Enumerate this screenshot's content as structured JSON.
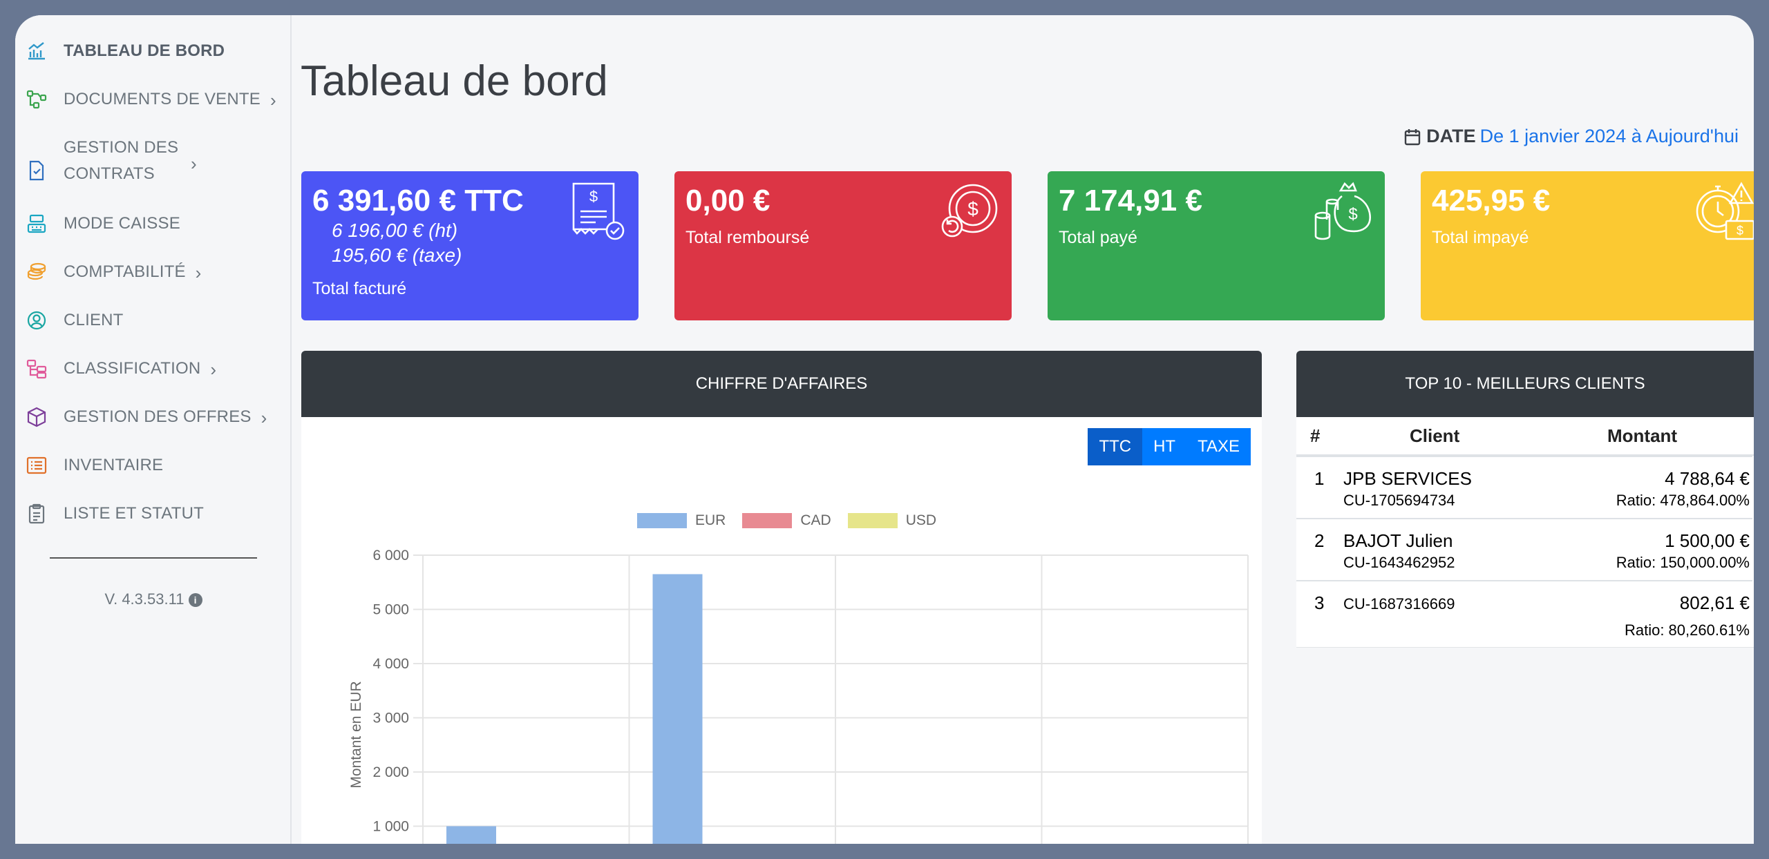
{
  "sidebar": {
    "items": [
      {
        "label": "TABLEAU DE BORD",
        "icon": "chart-icon",
        "color": "#2f98c9",
        "active": true
      },
      {
        "label": "DOCUMENTS DE VENTE",
        "icon": "share-nodes-icon",
        "color": "#3aa44e",
        "chevron": "›"
      },
      {
        "label": "GESTION DES CONTRATS",
        "icon": "contract-icon",
        "color": "#2f6fbf",
        "chevron": "›"
      },
      {
        "label": "MODE CAISSE",
        "icon": "cash-register-icon",
        "color": "#19a6c2"
      },
      {
        "label": "COMPTABILITÉ",
        "icon": "coins-icon",
        "color": "#f0a030",
        "chevron": "›"
      },
      {
        "label": "CLIENT",
        "icon": "user-circle-icon",
        "color": "#19a6a2"
      },
      {
        "label": "CLASSIFICATION",
        "icon": "folder-tree-icon",
        "color": "#e05a9a",
        "chevron": "›"
      },
      {
        "label": "GESTION DES OFFRES",
        "icon": "box-icon",
        "color": "#7d3f9a",
        "chevron": "›"
      },
      {
        "label": "INVENTAIRE",
        "icon": "list-icon",
        "color": "#e0702a"
      },
      {
        "label": "LISTE ET STATUT",
        "icon": "clipboard-icon",
        "color": "#6c757d"
      }
    ],
    "version": "V. 4.3.53.11"
  },
  "header": {
    "title": "Tableau de bord",
    "date_label": "DATE",
    "date_range": "De 1 janvier 2024 à Aujourd'hui"
  },
  "cards": [
    {
      "amount": "6 391,60 € TTC",
      "sub1": "6 196,00 € (ht)",
      "sub2": "195,60 € (taxe)",
      "caption": "Total facturé",
      "color": "#4c55f5",
      "icon": "receipt-icon"
    },
    {
      "amount": "0,00 €",
      "caption": "Total remboursé",
      "color": "#dc3545",
      "icon": "refund-icon"
    },
    {
      "amount": "7 174,91 €",
      "caption": "Total payé",
      "color": "#35a853",
      "icon": "money-bag-icon"
    },
    {
      "amount": "425,95 €",
      "caption": "Total impayé",
      "color": "#fbc932",
      "icon": "overdue-icon"
    }
  ],
  "revenue_panel": {
    "title": "CHIFFRE D'AFFAIRES",
    "buttons": [
      "TTC",
      "HT",
      "TAXE"
    ],
    "active_button": "TTC"
  },
  "chart_data": {
    "type": "bar",
    "ylabel": "Montant en EUR",
    "ylim": [
      0,
      6000
    ],
    "yticks": [
      "1 000",
      "2 000",
      "3 000",
      "4 000",
      "5 000",
      "6 000"
    ],
    "grid": true,
    "legend_position": "top",
    "series": [
      {
        "name": "EUR",
        "color": "#8db5e6",
        "values": [
          1000,
          5650,
          null,
          null
        ]
      },
      {
        "name": "CAD",
        "color": "#e88a92",
        "values": [
          null,
          null,
          null,
          null
        ]
      },
      {
        "name": "USD",
        "color": "#e6e58a",
        "values": [
          null,
          null,
          null,
          null
        ]
      }
    ]
  },
  "top_clients": {
    "title": "TOP 10 - MEILLEURS CLIENTS",
    "headers": [
      "#",
      "Client",
      "Montant"
    ],
    "rows": [
      {
        "rank": "1",
        "name": "JPB SERVICES",
        "code": "CU-1705694734",
        "amount": "4 788,64 €",
        "ratio": "Ratio: 478,864.00%"
      },
      {
        "rank": "2",
        "name": "BAJOT Julien",
        "code": "CU-1643462952",
        "amount": "1 500,00 €",
        "ratio": "Ratio: 150,000.00%"
      },
      {
        "rank": "3",
        "name": "",
        "code": "CU-1687316669",
        "amount": "802,61 €",
        "ratio": "Ratio: 80,260.61%"
      }
    ]
  }
}
